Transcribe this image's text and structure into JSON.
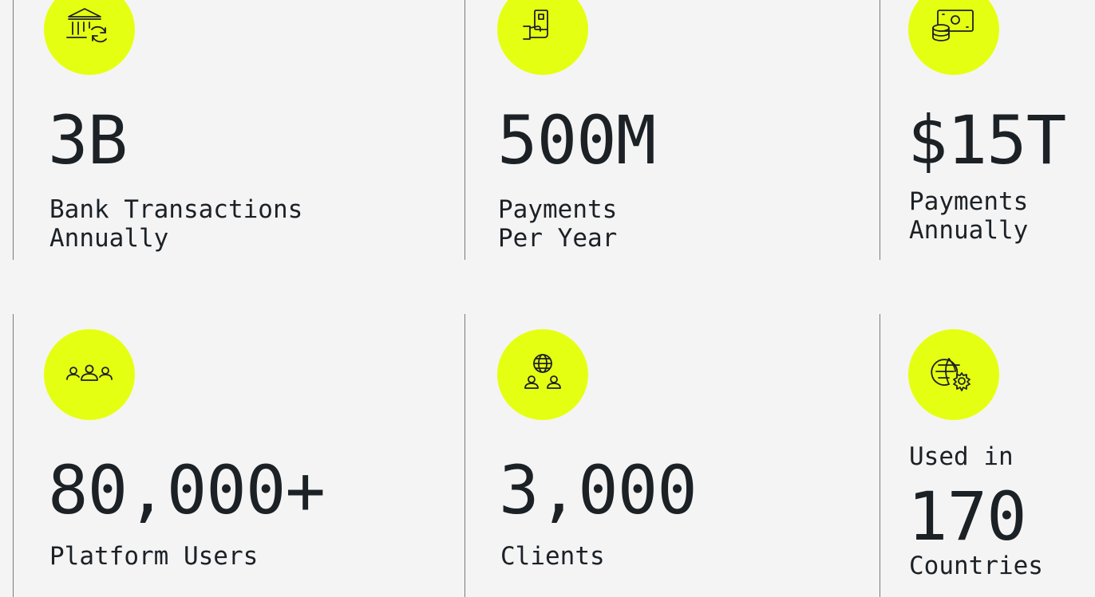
{
  "stats": [
    {
      "icon": "bank-transfer-icon",
      "value": "3B",
      "label": "Bank Transactions\nAnnually"
    },
    {
      "icon": "payment-card-hand-icon",
      "value": "500M",
      "label": "Payments\nPer Year"
    },
    {
      "icon": "cash-coins-icon",
      "value": "$15T",
      "label": "Payments\nAnnually"
    },
    {
      "icon": "users-group-icon",
      "value": "80,000+",
      "label": "Platform Users"
    },
    {
      "icon": "globe-clients-icon",
      "value": "3,000",
      "label": "Clients"
    },
    {
      "icon": "globe-gear-icon",
      "prefix": "Used in",
      "value": "170",
      "label": "Countries"
    }
  ],
  "colors": {
    "accent": "#e5ff12",
    "background": "#f4f4f4",
    "text": "#1c2126",
    "divider": "#7a7a7a"
  }
}
